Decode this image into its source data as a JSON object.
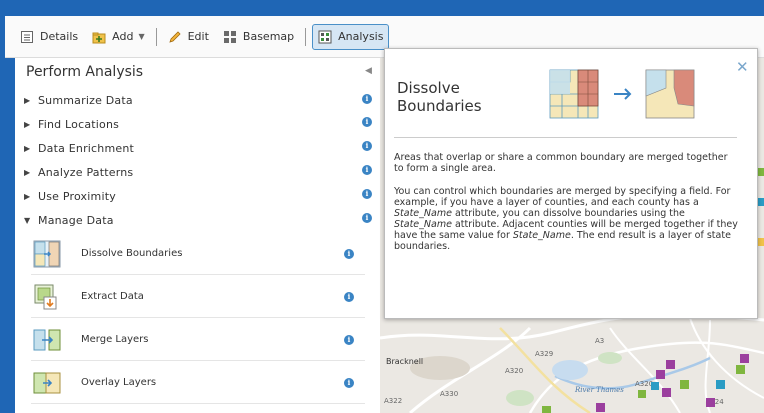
{
  "toolbar": {
    "details": "Details",
    "add": "Add",
    "edit": "Edit",
    "basemap": "Basemap",
    "analysis": "Analysis"
  },
  "panel": {
    "title": "Perform Analysis",
    "categories": [
      {
        "label": "Summarize Data",
        "expanded": false
      },
      {
        "label": "Find Locations",
        "expanded": false
      },
      {
        "label": "Data Enrichment",
        "expanded": false
      },
      {
        "label": "Analyze Patterns",
        "expanded": false
      },
      {
        "label": "Use Proximity",
        "expanded": false
      },
      {
        "label": "Manage Data",
        "expanded": true
      }
    ],
    "tools": [
      {
        "label": "Dissolve Boundaries"
      },
      {
        "label": "Extract Data"
      },
      {
        "label": "Merge Layers"
      },
      {
        "label": "Overlay Layers"
      }
    ]
  },
  "popup": {
    "title": "Dissolve Boundaries",
    "p1": "Areas that overlap or share a common boundary are merged together to form a single area.",
    "p2_a": "You can control which boundaries are merged by specifying a field. For example, if you have a layer of counties, and each county has a ",
    "p2_em1": "State_Name",
    "p2_b": " attribute, you can dissolve boundaries using the ",
    "p2_em2": "State_Name",
    "p2_c": " attribute. Adjacent counties will be merged together if they have the same value for ",
    "p2_em3": "State_Name",
    "p2_d": ". The end result is a layer of state boundaries."
  },
  "map": {
    "place_label": "Bracknell",
    "road_labels": [
      "A329",
      "A320",
      "A3",
      "A320",
      "A322",
      "A330",
      "A24"
    ],
    "river_label": "River Thames"
  },
  "colors": {
    "frame": "#1f66b5",
    "accent": "#3a84c4",
    "marker_purple": "#9b3f9e",
    "marker_green": "#7fb63f",
    "marker_teal": "#2a9cc4"
  }
}
